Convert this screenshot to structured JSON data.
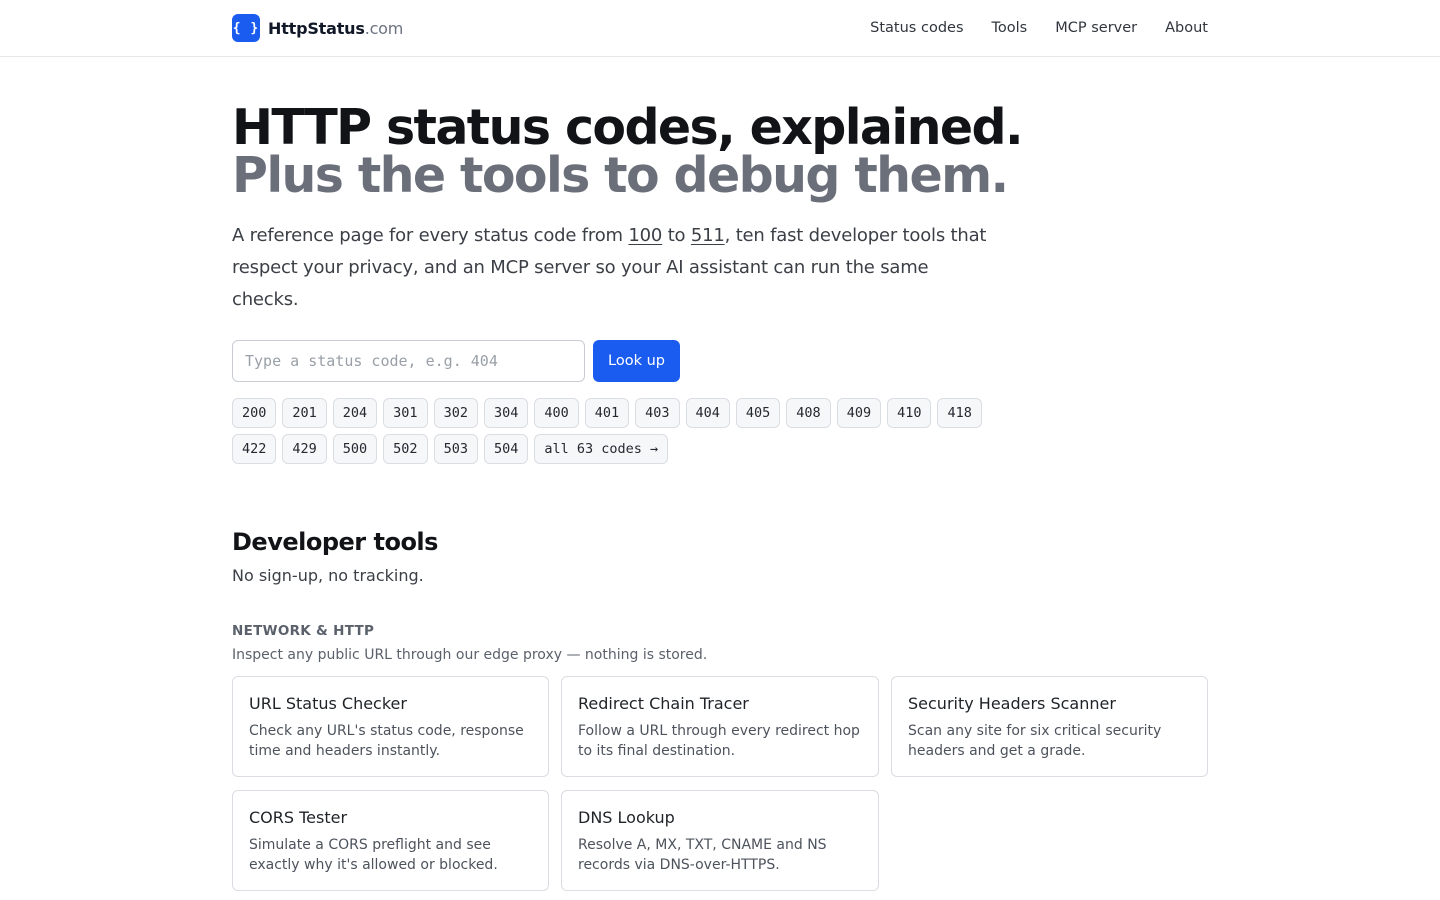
{
  "header": {
    "logo_glyph": "{ }",
    "brand_name": "HttpStatus",
    "brand_tld": ".com",
    "nav": [
      "Status codes",
      "Tools",
      "MCP server",
      "About"
    ]
  },
  "hero": {
    "title": "HTTP status codes, explained.",
    "subtitle": "Plus the tools to debug them.",
    "desc_part1": "A reference page for every status code from ",
    "desc_link1": "100",
    "desc_part2": " to ",
    "desc_link2": "511",
    "desc_part3": ", ten fast developer tools that respect your privacy, and an MCP server so your AI assistant can run the same checks."
  },
  "lookup": {
    "placeholder": "Type a status code, e.g. 404",
    "button_label": "Look up"
  },
  "codes": [
    "200",
    "201",
    "204",
    "301",
    "302",
    "304",
    "400",
    "401",
    "403",
    "404",
    "405",
    "408",
    "409",
    "410",
    "418",
    "422",
    "429",
    "500",
    "502",
    "503",
    "504"
  ],
  "all_codes_label": "all 63 codes →",
  "tools": {
    "title": "Developer tools",
    "subtitle": "No sign-up, no tracking.",
    "group_title": "NETWORK & HTTP",
    "group_desc": "Inspect any public URL through our edge proxy — nothing is stored.",
    "cards": [
      {
        "title": "URL Status Checker",
        "desc": "Check any URL's status code, response time and headers instantly."
      },
      {
        "title": "Redirect Chain Tracer",
        "desc": "Follow a URL through every redirect hop to its final destination."
      },
      {
        "title": "Security Headers Scanner",
        "desc": "Scan any site for six critical security headers and get a grade."
      },
      {
        "title": "CORS Tester",
        "desc": "Simulate a CORS preflight and see exactly why it's allowed or blocked."
      },
      {
        "title": "DNS Lookup",
        "desc": "Resolve A, MX, TXT, CNAME and NS records via DNS-over-HTTPS."
      }
    ]
  },
  "colors": {
    "accent": "#1a5cf0",
    "title": "#111317",
    "subtitle_gray": "#6b6f7a",
    "border": "#dadde2"
  }
}
